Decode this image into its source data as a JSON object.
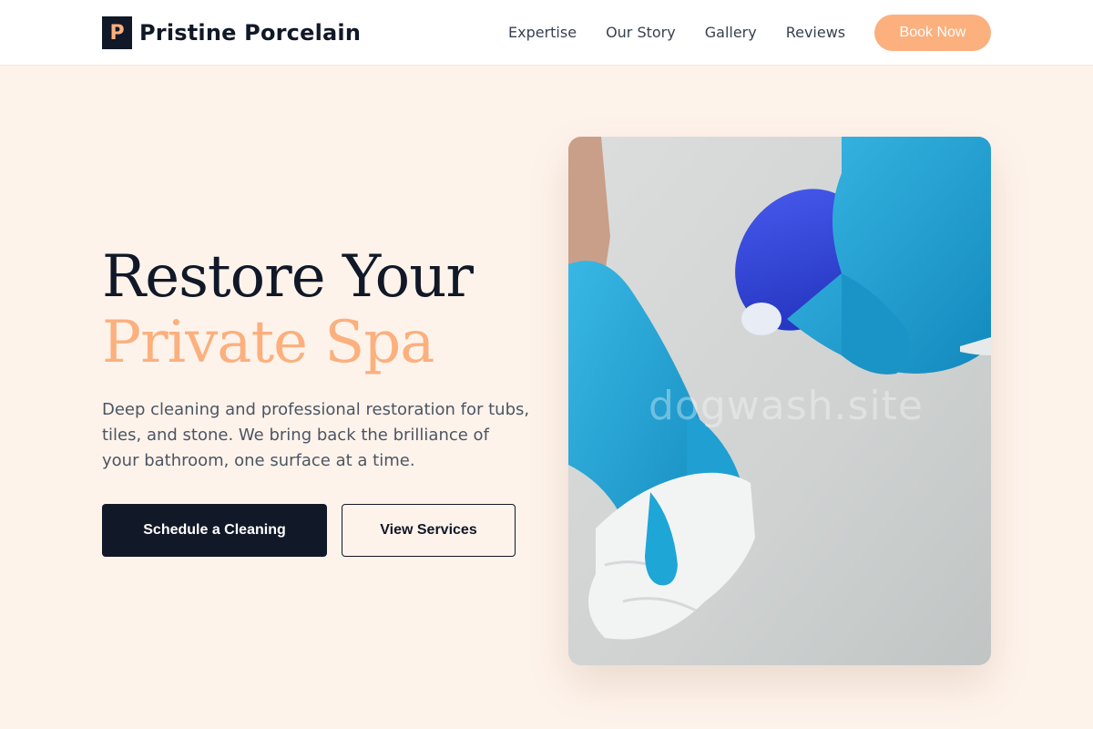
{
  "brand": {
    "mark": "P",
    "name": "Pristine Porcelain"
  },
  "nav": {
    "links": [
      "Expertise",
      "Our Story",
      "Gallery",
      "Reviews"
    ],
    "cta": "Book Now"
  },
  "hero": {
    "title_line1": "Restore Your",
    "title_line2": "Private Spa",
    "description": "Deep cleaning and professional restoration for tubs, tiles, and stone. We bring back the brilliance of your bathroom, one surface at a time.",
    "primary_button": "Schedule a Cleaning",
    "secondary_button": "View Services",
    "image_watermark": "dogwash.site"
  },
  "colors": {
    "accent": "#fbb07e",
    "dark": "#111827",
    "background": "#fef3eb",
    "glove": "#1ea6d6",
    "spray_bottle": "#2b3fd6"
  },
  "icons": {
    "brand_mark": "brand-logo-icon"
  }
}
